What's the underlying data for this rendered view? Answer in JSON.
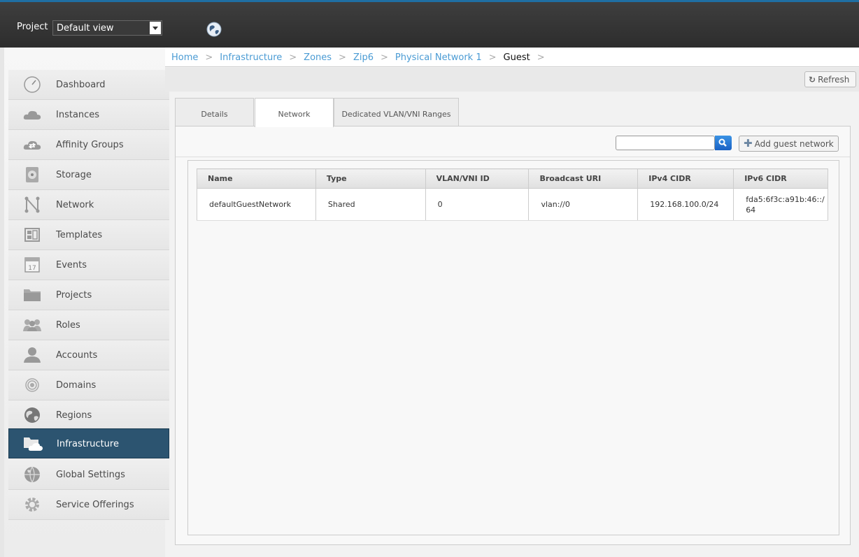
{
  "header": {
    "project_label": "Project",
    "project_value": "Default view",
    "icon": "globe-icon"
  },
  "breadcrumb": [
    "Home",
    "Infrastructure",
    "Zones",
    "Zip6",
    "Physical Network 1",
    "Guest"
  ],
  "breadcrumb_separator": ">",
  "sidebar": {
    "items": [
      {
        "label": "Dashboard",
        "icon": "dashboard-icon"
      },
      {
        "label": "Instances",
        "icon": "cloud-icon"
      },
      {
        "label": "Affinity Groups",
        "icon": "affinity-icon"
      },
      {
        "label": "Storage",
        "icon": "storage-icon"
      },
      {
        "label": "Network",
        "icon": "network-icon"
      },
      {
        "label": "Templates",
        "icon": "templates-icon"
      },
      {
        "label": "Events",
        "icon": "calendar-icon"
      },
      {
        "label": "Projects",
        "icon": "folder-icon"
      },
      {
        "label": "Roles",
        "icon": "roles-icon"
      },
      {
        "label": "Accounts",
        "icon": "user-icon"
      },
      {
        "label": "Domains",
        "icon": "domains-icon"
      },
      {
        "label": "Regions",
        "icon": "globe-icon"
      },
      {
        "label": "Infrastructure",
        "icon": "infrastructure-icon"
      },
      {
        "label": "Global Settings",
        "icon": "world-icon"
      },
      {
        "label": "Service Offerings",
        "icon": "gear-icon"
      }
    ],
    "active": "Infrastructure",
    "calendar_day": "17"
  },
  "toolbar": {
    "refresh_label": "Refresh"
  },
  "tabs": [
    "Details",
    "Network",
    "Dedicated VLAN/VNI Ranges"
  ],
  "active_tab": "Network",
  "list": {
    "add_label": "Add guest network",
    "columns": [
      "Name",
      "Type",
      "VLAN/VNI ID",
      "Broadcast URI",
      "IPv4 CIDR",
      "IPv6 CIDR"
    ],
    "rows": [
      [
        "defaultGuestNetwork",
        "Shared",
        "0",
        "vlan://0",
        "192.168.100.0/24",
        "fda5:6f3c:a91b:46::/64"
      ]
    ]
  },
  "colors": {
    "header_bg": "#333333",
    "active_nav": "#2c5470",
    "link": "#4a9bd4"
  }
}
